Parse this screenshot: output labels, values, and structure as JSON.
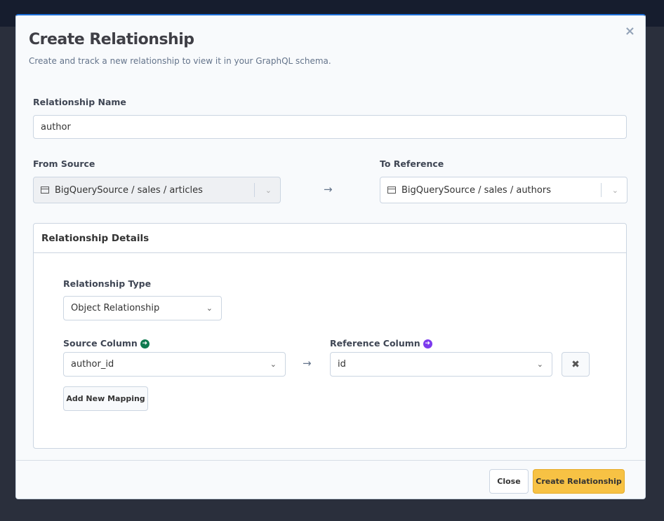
{
  "modal": {
    "title": "Create Relationship",
    "subtitle": "Create and track a new relationship to view it in your GraphQL schema.",
    "close_icon": "×"
  },
  "form": {
    "name_label": "Relationship Name",
    "name_value": "author",
    "from_label": "From Source",
    "from_value": "BigQuerySource / sales / articles",
    "to_label": "To Reference",
    "to_value": "BigQuerySource / sales / authors"
  },
  "details": {
    "title": "Relationship Details",
    "type_label": "Relationship Type",
    "type_value": "Object Relationship",
    "source_col_label": "Source Column",
    "source_col_value": "author_id",
    "ref_col_label": "Reference Column",
    "ref_col_value": "id",
    "add_mapping": "Add New Mapping",
    "source_color": "#0e7a4f",
    "ref_color": "#7c3aed"
  },
  "footer": {
    "close": "Close",
    "create": "Create Relationship",
    "create_color": "#f7c244"
  }
}
